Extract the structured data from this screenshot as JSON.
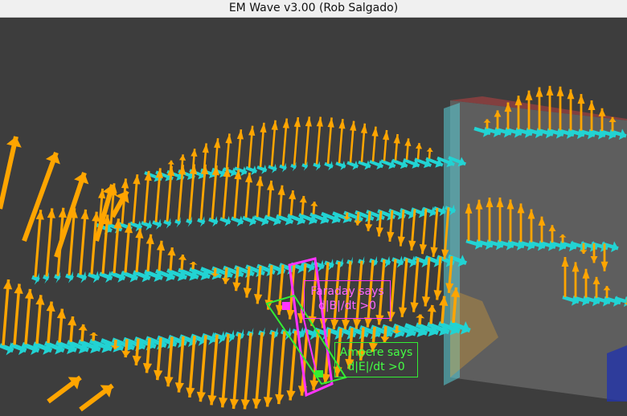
{
  "window": {
    "title": "EM Wave v3.00 (Rob Salgado)"
  },
  "annotations": {
    "faraday": {
      "line1": "Faraday says",
      "line2": "d|B|/dt >0"
    },
    "ampere": {
      "line1": "Ampere says",
      "line2": "d|E|/dt >0"
    }
  },
  "colors": {
    "background": "#3d3d3d",
    "electric_field": "#ffa500",
    "magnetic_field": "#22d3d3",
    "faraday_loop": "#ff33ff",
    "ampere_loop": "#33ee33"
  }
}
